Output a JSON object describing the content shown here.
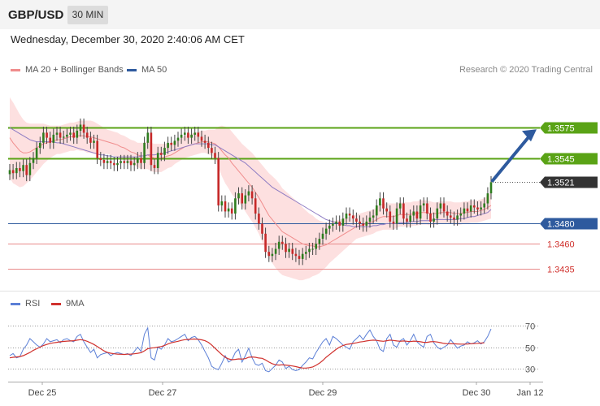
{
  "header": {
    "symbol": "GBP/USD",
    "timeframe": "30 MIN"
  },
  "datetime": "Wednesday, December 30, 2020 2:40:06 AM CET",
  "legend_main": [
    {
      "label": "MA 20 + Bollinger Bands",
      "color": "#f08c8c"
    },
    {
      "label": "MA 50",
      "color": "#2e5a9e"
    }
  ],
  "copyright": "Research © 2020 Trading Central",
  "legend_rsi": [
    {
      "label": "RSI",
      "color": "#5b7fd6"
    },
    {
      "label": "9MA",
      "color": "#d0312d"
    }
  ],
  "colors": {
    "green": "#5aa316",
    "blue": "#2e5a9e",
    "red": "#d0312d",
    "band": "#fde0e0",
    "dark": "#333333"
  },
  "chart_data": [
    {
      "type": "candlestick",
      "title": "",
      "ylim": [
        1.3412,
        1.3625
      ],
      "x_ticks": [
        "Dec 25",
        "Dec 27",
        "Dec 29",
        "Dec 30",
        "Jan 12"
      ],
      "levels": [
        {
          "label": "1.3575",
          "value": 1.3575,
          "kind": "resistance"
        },
        {
          "label": "1.3545",
          "value": 1.3545,
          "kind": "resistance"
        },
        {
          "label": "1.3521",
          "value": 1.3521,
          "kind": "last"
        },
        {
          "label": "1.3480",
          "value": 1.348,
          "kind": "pivot"
        },
        {
          "label": "1.3460",
          "value": 1.346,
          "kind": "support"
        },
        {
          "label": "1.3435",
          "value": 1.3435,
          "kind": "support"
        }
      ],
      "last_price": 1.3521,
      "projection": {
        "from": 1.3521,
        "to": 1.3575
      },
      "close": [
        1.3533,
        1.353,
        1.3535,
        1.3532,
        1.3538,
        1.3528,
        1.354,
        1.3545,
        1.3555,
        1.356,
        1.357,
        1.3565,
        1.356,
        1.3568,
        1.357,
        1.3565,
        1.3566,
        1.3568,
        1.357,
        1.3565,
        1.3572,
        1.3578,
        1.357,
        1.3565,
        1.356,
        1.3562,
        1.3545,
        1.3543,
        1.354,
        1.3542,
        1.354,
        1.3538,
        1.354,
        1.3542,
        1.354,
        1.3542,
        1.3538,
        1.354,
        1.3545,
        1.354,
        1.356,
        1.357,
        1.3538,
        1.3535,
        1.355,
        1.3548,
        1.3555,
        1.356,
        1.3558,
        1.3562,
        1.3565,
        1.3568,
        1.357,
        1.3565,
        1.3568,
        1.357,
        1.3566,
        1.3562,
        1.356,
        1.3555,
        1.355,
        1.3545,
        1.3498,
        1.3502,
        1.3492,
        1.3495,
        1.349,
        1.3505,
        1.351,
        1.35,
        1.3508,
        1.3512,
        1.3505,
        1.349,
        1.348,
        1.347,
        1.3452,
        1.3448,
        1.345,
        1.3455,
        1.3462,
        1.346,
        1.3452,
        1.3455,
        1.345,
        1.3448,
        1.3445,
        1.345,
        1.3452,
        1.3455,
        1.3455,
        1.346,
        1.3465,
        1.347,
        1.3475,
        1.3478,
        1.348,
        1.3482,
        1.3478,
        1.3485,
        1.349,
        1.3488,
        1.3485,
        1.3482,
        1.348,
        1.3478,
        1.3482,
        1.3486,
        1.3488,
        1.3498,
        1.3505,
        1.3495,
        1.3492,
        1.3482,
        1.348,
        1.3495,
        1.35,
        1.3485,
        1.3482,
        1.3488,
        1.3492,
        1.3485,
        1.3498,
        1.35,
        1.349,
        1.3482,
        1.3485,
        1.3495,
        1.35,
        1.3492,
        1.3488,
        1.3486,
        1.3484,
        1.3488,
        1.349,
        1.3495,
        1.3492,
        1.3498,
        1.3496,
        1.3494,
        1.3496,
        1.35,
        1.351,
        1.3521
      ],
      "ma20": [
        1.3565,
        1.356,
        1.3556,
        1.3552,
        1.355,
        1.355,
        1.3551,
        1.3553,
        1.3555,
        1.3557,
        1.3559,
        1.356,
        1.3561,
        1.3562,
        1.3563,
        1.3563,
        1.3564,
        1.3565,
        1.3566,
        1.3566,
        1.3567,
        1.3567,
        1.3567,
        1.3566,
        1.3566,
        1.3565,
        1.3564,
        1.3563,
        1.3562,
        1.3561,
        1.356,
        1.3559,
        1.3558,
        1.3556,
        1.3555,
        1.3553,
        1.3551,
        1.355,
        1.3548,
        1.3547,
        1.3547,
        1.3548,
        1.3546,
        1.3545,
        1.3545,
        1.3545,
        1.3546,
        1.3547,
        1.3548,
        1.355,
        1.3552,
        1.3554,
        1.3556,
        1.3557,
        1.3558,
        1.3559,
        1.356,
        1.3561,
        1.3561,
        1.3561,
        1.356,
        1.3559,
        1.3556,
        1.3552,
        1.3548,
        1.3545,
        1.354,
        1.3536,
        1.3532,
        1.3528,
        1.3524,
        1.352,
        1.3516,
        1.3511,
        1.3506,
        1.35,
        1.3494,
        1.3488,
        1.3484,
        1.348,
        1.3476,
        1.3472,
        1.347,
        1.3468,
        1.3466,
        1.3464,
        1.3462,
        1.346,
        1.3459,
        1.3458,
        1.3458,
        1.3457,
        1.3457,
        1.3458,
        1.3459,
        1.3461,
        1.3463,
        1.3465,
        1.3467,
        1.3469,
        1.3471,
        1.3473,
        1.3475,
        1.3477,
        1.3478,
        1.3479,
        1.348,
        1.3481,
        1.3482,
        1.3484,
        1.3486,
        1.3487,
        1.3487,
        1.3487,
        1.3487,
        1.3488,
        1.3489,
        1.3489,
        1.3489,
        1.3489,
        1.349,
        1.349,
        1.3491,
        1.3491,
        1.3491,
        1.349,
        1.349,
        1.349,
        1.3491,
        1.3491,
        1.3491,
        1.3491,
        1.349,
        1.349,
        1.349,
        1.3491,
        1.3491,
        1.3492,
        1.3492,
        1.3492,
        1.3493,
        1.3494,
        1.3496,
        1.3498
      ],
      "ma50": [
        1.3575,
        1.3573,
        1.3571,
        1.3569,
        1.3567,
        1.3565,
        1.3563,
        1.3562,
        1.3561,
        1.3561,
        1.3561,
        1.3561,
        1.3561,
        1.3561,
        1.356,
        1.356,
        1.3559,
        1.3558,
        1.3557,
        1.3556,
        1.3555,
        1.3554,
        1.3553,
        1.3552,
        1.3551,
        1.355,
        1.3549,
        1.3548,
        1.3548,
        1.3547,
        1.3547,
        1.3546,
        1.3546,
        1.3546,
        1.3546,
        1.3546,
        1.3546,
        1.3546,
        1.3546,
        1.3547,
        1.3547,
        1.3548,
        1.3548,
        1.3548,
        1.3549,
        1.3549,
        1.355,
        1.3551,
        1.3552,
        1.3553,
        1.3554,
        1.3555,
        1.3556,
        1.3557,
        1.3558,
        1.3559,
        1.3559,
        1.3559,
        1.3559,
        1.3559,
        1.3558,
        1.3558,
        1.3556,
        1.3554,
        1.3552,
        1.355,
        1.3548,
        1.3546,
        1.3544,
        1.3542,
        1.354,
        1.3537,
        1.3534,
        1.3531,
        1.3528,
        1.3525,
        1.3522,
        1.3519,
        1.3516,
        1.3514,
        1.3512,
        1.351,
        1.3508,
        1.3506,
        1.3504,
        1.3502,
        1.35,
        1.3498,
        1.3496,
        1.3494,
        1.3492,
        1.349,
        1.3488,
        1.3486,
        1.3484,
        1.3483,
        1.3482,
        1.3481,
        1.348,
        1.3479,
        1.3478,
        1.3478,
        1.3477,
        1.3477,
        1.3477,
        1.3477,
        1.3477,
        1.3477,
        1.3478,
        1.3478,
        1.3479,
        1.3479,
        1.348,
        1.348,
        1.348,
        1.348,
        1.3481,
        1.3481,
        1.3481,
        1.3482,
        1.3482,
        1.3482,
        1.3483,
        1.3483,
        1.3483,
        1.3483,
        1.3484,
        1.3484,
        1.3484,
        1.3484,
        1.3484,
        1.3484,
        1.3484,
        1.3484,
        1.3485,
        1.3485,
        1.3486,
        1.3487,
        1.3487,
        1.3488,
        1.3489,
        1.349,
        1.3491,
        1.3494
      ],
      "bb_width": [
        0.004,
        0.004,
        0.0038,
        0.0036,
        0.0033,
        0.003,
        0.0028,
        0.0026,
        0.0024,
        0.0022,
        0.002,
        0.0018,
        0.0016,
        0.0015,
        0.0014,
        0.0014,
        0.0014,
        0.0014,
        0.0014,
        0.0014,
        0.0014,
        0.0015,
        0.0015,
        0.0016,
        0.0016,
        0.0016,
        0.0015,
        0.0014,
        0.0013,
        0.0012,
        0.0012,
        0.0012,
        0.0012,
        0.0012,
        0.0012,
        0.0012,
        0.0012,
        0.0012,
        0.0012,
        0.0013,
        0.0013,
        0.0014,
        0.0014,
        0.0014,
        0.0014,
        0.0014,
        0.0013,
        0.0012,
        0.0012,
        0.0011,
        0.0011,
        0.0011,
        0.0011,
        0.0011,
        0.0011,
        0.0011,
        0.0011,
        0.0011,
        0.0011,
        0.0012,
        0.0013,
        0.0014,
        0.002,
        0.0025,
        0.0028,
        0.003,
        0.0031,
        0.0031,
        0.0031,
        0.0031,
        0.0032,
        0.0033,
        0.0034,
        0.0035,
        0.0036,
        0.0038,
        0.004,
        0.0042,
        0.0043,
        0.0044,
        0.0044,
        0.0043,
        0.0042,
        0.0041,
        0.004,
        0.0039,
        0.0038,
        0.0036,
        0.0034,
        0.0032,
        0.003,
        0.0028,
        0.0026,
        0.0024,
        0.0022,
        0.002,
        0.0019,
        0.0018,
        0.0017,
        0.0016,
        0.0015,
        0.0014,
        0.0013,
        0.0012,
        0.0012,
        0.0012,
        0.0012,
        0.0012,
        0.0012,
        0.0012,
        0.0013,
        0.0013,
        0.0013,
        0.0013,
        0.0013,
        0.0012,
        0.0012,
        0.0012,
        0.0012,
        0.0012,
        0.0012,
        0.0012,
        0.0012,
        0.0012,
        0.0012,
        0.0012,
        0.0011,
        0.0011,
        0.0011,
        0.0011,
        0.0011,
        0.0011,
        0.0011,
        0.0011,
        0.0011,
        0.0011,
        0.0011,
        0.0011,
        0.0011,
        0.0011,
        0.0011,
        0.0011,
        0.0012,
        0.0013
      ]
    },
    {
      "type": "line",
      "title": "",
      "ylim": [
        20,
        80
      ],
      "y_ticks": [
        70,
        50,
        30
      ],
      "series": [
        {
          "name": "RSI",
          "values": [
            42,
            44,
            40,
            41,
            48,
            52,
            58,
            55,
            52,
            50,
            53,
            58,
            55,
            56,
            57,
            54,
            57,
            58,
            56,
            55,
            60,
            62,
            55,
            50,
            45,
            48,
            40,
            43,
            44,
            45,
            42,
            44,
            45,
            44,
            43,
            44,
            42,
            46,
            50,
            46,
            62,
            68,
            40,
            38,
            50,
            48,
            52,
            58,
            55,
            56,
            58,
            60,
            62,
            56,
            59,
            60,
            57,
            52,
            46,
            40,
            32,
            30,
            29,
            35,
            42,
            36,
            38,
            45,
            48,
            36,
            42,
            49,
            40,
            34,
            33,
            35,
            28,
            27,
            30,
            33,
            38,
            36,
            30,
            32,
            29,
            28,
            29,
            33,
            36,
            40,
            39,
            45,
            50,
            55,
            58,
            52,
            60,
            58,
            55,
            52,
            50,
            48,
            55,
            58,
            61,
            57,
            62,
            66,
            60,
            56,
            48,
            46,
            58,
            62,
            52,
            50,
            56,
            58,
            52,
            56,
            62,
            55,
            52,
            50,
            60,
            62,
            54,
            50,
            48,
            50,
            52,
            57,
            53,
            49,
            51,
            52,
            55,
            53,
            54,
            56,
            53,
            55,
            60,
            67
          ]
        },
        {
          "name": "9MA",
          "values": [
            40,
            40.5,
            40.8,
            41.2,
            42,
            43.5,
            45,
            47,
            48.5,
            50,
            51.5,
            52.5,
            53.5,
            54,
            54.5,
            55,
            55.3,
            55.6,
            55.8,
            56,
            56.5,
            57,
            56.5,
            55.5,
            54,
            52.5,
            50.5,
            48.5,
            46.5,
            45,
            44.3,
            43.8,
            43.5,
            43.3,
            43.2,
            43.4,
            43.5,
            43.8,
            44.2,
            44.8,
            46.5,
            48.5,
            49.2,
            49.5,
            50,
            50.5,
            51.5,
            53,
            54,
            54.8,
            55.5,
            56.3,
            57,
            57.2,
            57.5,
            57.6,
            57.3,
            56.8,
            56,
            54.5,
            52,
            49,
            46,
            43,
            40.5,
            39,
            38.2,
            38.5,
            39,
            38.8,
            39.2,
            40.5,
            40.8,
            40.5,
            39.8,
            39.5,
            38,
            36,
            34.5,
            33.5,
            33.2,
            33.5,
            33.2,
            32.8,
            32.4,
            31.8,
            31,
            30.5,
            30.4,
            30.8,
            31.5,
            33,
            35,
            37.5,
            40.5,
            43,
            45.5,
            48,
            50,
            51.5,
            52.5,
            53,
            53.5,
            54,
            54.8,
            55.2,
            55.8,
            56.2,
            56.5,
            56.3,
            55.8,
            55.5,
            56,
            56.5,
            56.2,
            55.8,
            55.5,
            55.8,
            55.5,
            55.2,
            55.6,
            55.5,
            55,
            54.5,
            54.5,
            55,
            55.2,
            54.8,
            54.2,
            53.5,
            53.2,
            53.3,
            53.2,
            53,
            52.8,
            52.8,
            53,
            53.2,
            53.4,
            53.6,
            53.8,
            54
          ]
        }
      ]
    }
  ]
}
